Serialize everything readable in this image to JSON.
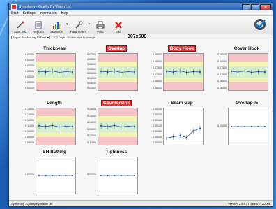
{
  "window": {
    "title": "Symphony - Quality By Vision Ltd."
  },
  "menu": [
    "Start",
    "Settings",
    "Information",
    "Help"
  ],
  "toolbar": {
    "buttons": [
      {
        "label": "Start Job",
        "icon": "start-job-icon"
      },
      {
        "label": "Reports",
        "icon": "reports-icon"
      },
      {
        "label": "Statistics",
        "icon": "statistics-icon"
      },
      {
        "label": "Parameters",
        "icon": "parameters-icon"
      },
      {
        "label": "Print",
        "icon": "print-icon"
      },
      {
        "label": "Exit",
        "icon": "exit-icon"
      }
    ]
  },
  "report": {
    "selected": "Report WinMaxi-Ing All Fond",
    "info": "100 Days - Double click to change"
  },
  "format_label": "307x500",
  "colors": {
    "alert": "#e23a3a",
    "red_band": "#f6c3c8",
    "yellow_band": "#f4f3b6",
    "green_band": "#d6f0cf"
  },
  "panels": [
    {
      "id": "thickness",
      "title": "Thickness",
      "alert": false,
      "bands": true,
      "ticks": [
        "0.00060",
        "0.00055",
        "0.00050",
        "0.00045",
        "0.00040",
        "0.00035",
        "0.00030"
      ]
    },
    {
      "id": "overlap",
      "title": "Overlap",
      "alert": true,
      "bands": true,
      "ticks": [
        "0.07000",
        "0.06500",
        "0.06000",
        "0.05500",
        "0.05000",
        "0.04500",
        "0.04000",
        "0.03500"
      ]
    },
    {
      "id": "body-hook",
      "title": "Body Hook",
      "alert": true,
      "bands": true,
      "ticks": [
        "0.08500",
        "0.08000",
        "0.07500",
        "0.07000",
        "0.06500",
        "0.06000"
      ]
    },
    {
      "id": "cover-hook",
      "title": "Cover Hook",
      "alert": false,
      "bands": true,
      "ticks": [
        "0.08500",
        "0.08000",
        "0.07500",
        "0.07000",
        "0.06500",
        "0.06000"
      ]
    },
    {
      "id": "length",
      "title": "Length",
      "alert": false,
      "bands": true,
      "ticks": [
        "0.14000",
        "0.13000",
        "0.12000",
        "0.11000",
        "0.10000",
        "0.09000",
        "0.08000"
      ]
    },
    {
      "id": "countersink",
      "title": "Countersink",
      "alert": true,
      "bands": true,
      "ticks": [
        "0.16000",
        "0.15000",
        "0.14000",
        "0.13000",
        "0.12000",
        "0.11000"
      ]
    },
    {
      "id": "seam-gap",
      "title": "Seam Gap",
      "alert": false,
      "bands": false,
      "ticks": [
        "0.00240",
        "0.00200",
        "0.00160",
        "0.00120",
        "0.00080",
        "0.00040",
        "0.00000"
      ]
    },
    {
      "id": "overlap-pct",
      "title": "Overlap %",
      "alert": false,
      "bands": false,
      "ticks": [
        "0.00000"
      ]
    },
    {
      "id": "bh-butting",
      "title": "BH Butting",
      "alert": false,
      "bands": false,
      "ticks": [
        "0.00000"
      ]
    },
    {
      "id": "tightness",
      "title": "Tightness",
      "alert": false,
      "bands": false,
      "ticks": [
        "0.00000"
      ]
    }
  ],
  "status": {
    "left": "Symphony - Quality By Vision Ltd.",
    "right": "Version: 2.5.8.17  Date:07/12/2006"
  }
}
